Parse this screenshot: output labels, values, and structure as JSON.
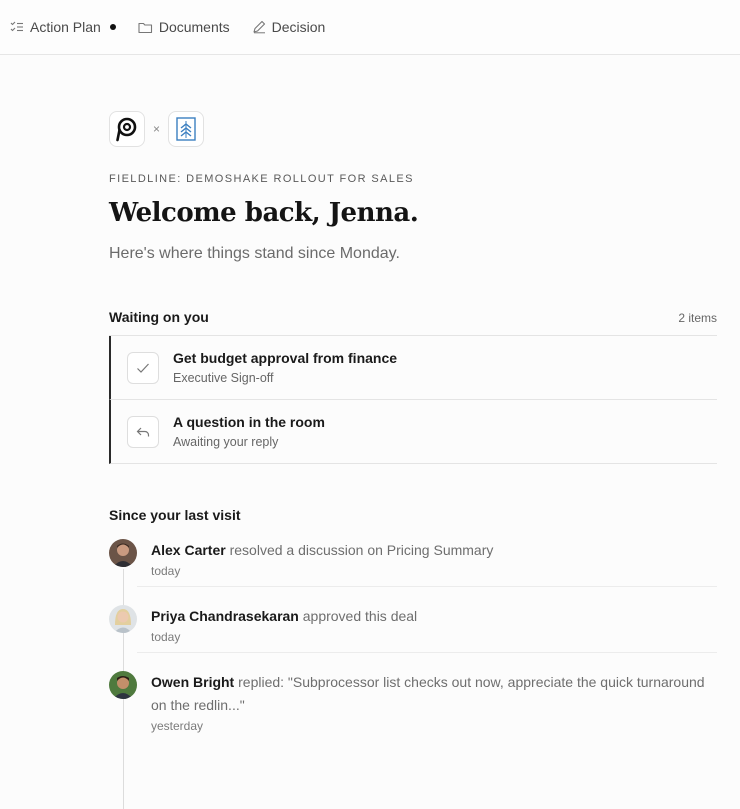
{
  "tabs": [
    {
      "label": "Action Plan",
      "icon": "checklist-icon",
      "active": true
    },
    {
      "label": "Documents",
      "icon": "folder-icon"
    },
    {
      "label": "Decision",
      "icon": "pen-icon"
    }
  ],
  "header": {
    "times_symbol": "×",
    "eyebrow": "FIELDLINE: DEMOSHAKE ROLLOUT FOR SALES",
    "title": "Welcome back, Jenna.",
    "subtitle": "Here's where things stand since Monday."
  },
  "waiting": {
    "heading": "Waiting on you",
    "count": "2 items",
    "items": [
      {
        "title": "Get budget approval from finance",
        "subtitle": "Executive Sign-off",
        "icon": "check-icon"
      },
      {
        "title": "A question in the room",
        "subtitle": "Awaiting your reply",
        "icon": "reply-icon"
      }
    ]
  },
  "since": {
    "heading": "Since your last visit",
    "items": [
      {
        "name": "Alex Carter",
        "text": " resolved a discussion on Pricing Summary",
        "time": "today"
      },
      {
        "name": "Priya Chandrasekaran",
        "text": " approved this deal",
        "time": "today"
      },
      {
        "name": "Owen Bright",
        "text": " replied: \"Subprocessor list checks out now, appreciate the quick turnaround on the redlin...\"",
        "time": "yesterday"
      }
    ]
  },
  "colors": {
    "accent": "#1d1d1d",
    "logo_blue": "#3b7fc0",
    "border": "#e4e4e4"
  }
}
